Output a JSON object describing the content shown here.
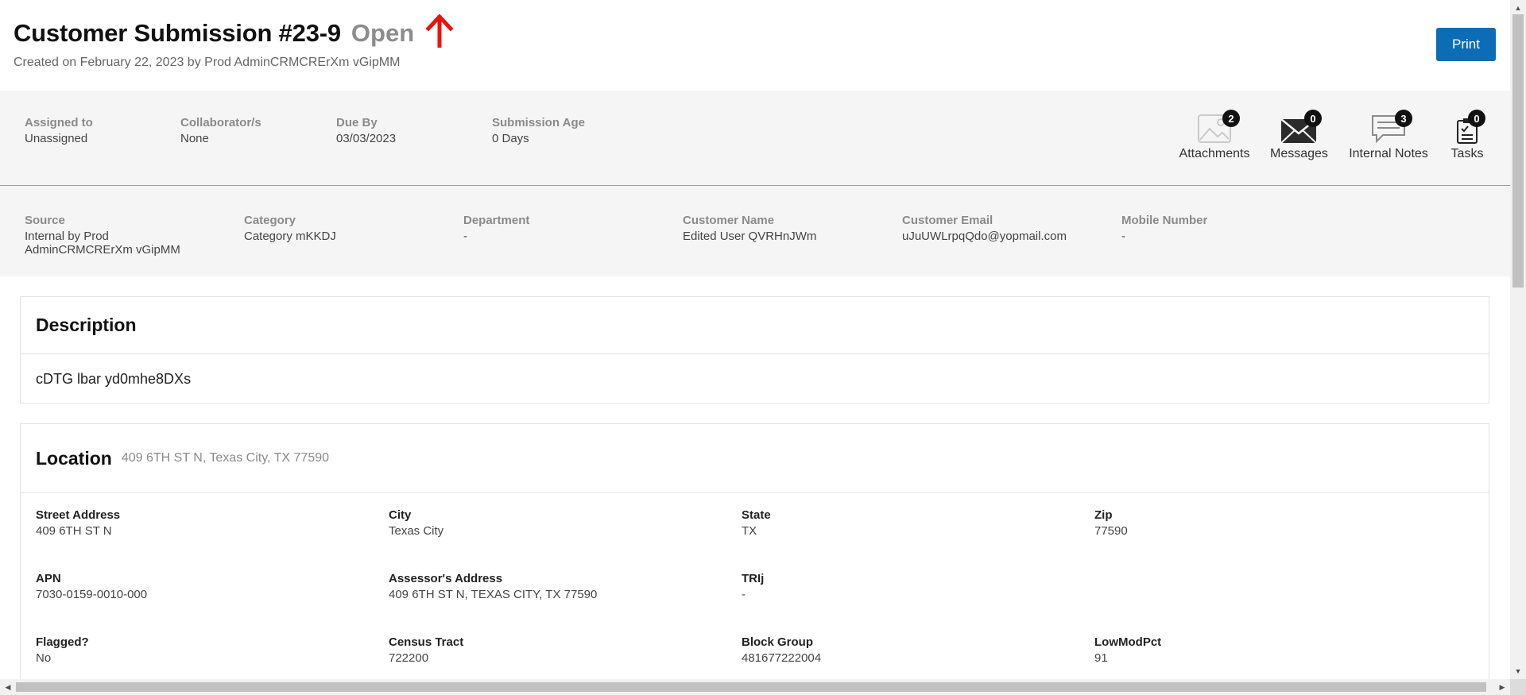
{
  "header": {
    "title": "Customer Submission #23-9",
    "status": "Open",
    "created": "Created on February 22, 2023 by Prod AdminCRMCRErXm vGipMM",
    "print_label": "Print"
  },
  "meta": {
    "assigned_label": "Assigned to",
    "assigned_value": "Unassigned",
    "collab_label": "Collaborator/s",
    "collab_value": "None",
    "due_label": "Due By",
    "due_value": "03/03/2023",
    "age_label": "Submission Age",
    "age_value": "0 Days"
  },
  "actions": {
    "attachments": {
      "label": "Attachments",
      "count": "2"
    },
    "messages": {
      "label": "Messages",
      "count": "0"
    },
    "notes": {
      "label": "Internal Notes",
      "count": "3"
    },
    "tasks": {
      "label": "Tasks",
      "count": "0"
    }
  },
  "info": {
    "source_label": "Source",
    "source_value": "Internal by Prod AdminCRMCRErXm vGipMM",
    "category_label": "Category",
    "category_value": "Category mKKDJ",
    "department_label": "Department",
    "department_value": "-",
    "customer_name_label": "Customer Name",
    "customer_name_value": "Edited User QVRHnJWm",
    "customer_email_label": "Customer Email",
    "customer_email_value": "uJuUWLrpqQdo@yopmail.com",
    "mobile_label": "Mobile Number",
    "mobile_value": "-"
  },
  "description": {
    "title": "Description",
    "text": "cDTG lbar yd0mhe8DXs"
  },
  "location": {
    "title": "Location",
    "address": "409 6TH ST N, Texas City, TX 77590",
    "street_label": "Street Address",
    "street_value": "409 6TH ST N",
    "city_label": "City",
    "city_value": "Texas City",
    "state_label": "State",
    "state_value": "TX",
    "zip_label": "Zip",
    "zip_value": "77590",
    "apn_label": "APN",
    "apn_value": "7030-0159-0010-000",
    "assessor_label": "Assessor's Address",
    "assessor_value": "409 6TH ST N, TEXAS CITY, TX 77590",
    "trij_label": "TRIj",
    "trij_value": "-",
    "flagged_label": "Flagged?",
    "flagged_value": "No",
    "census_label": "Census Tract",
    "census_value": "722200",
    "block_label": "Block Group",
    "block_value": "481677222004",
    "lowmod_label": "LowModPct",
    "lowmod_value": "91"
  },
  "colors": {
    "accent": "#0c6cb5",
    "status_arrow": "#e8140e",
    "band_bg": "#f5f5f5"
  },
  "icons": {
    "priority": "arrow-up-icon",
    "attachments": "image-icon",
    "messages": "envelope-icon",
    "notes": "chat-bubble-icon",
    "tasks": "clipboard-icon"
  }
}
